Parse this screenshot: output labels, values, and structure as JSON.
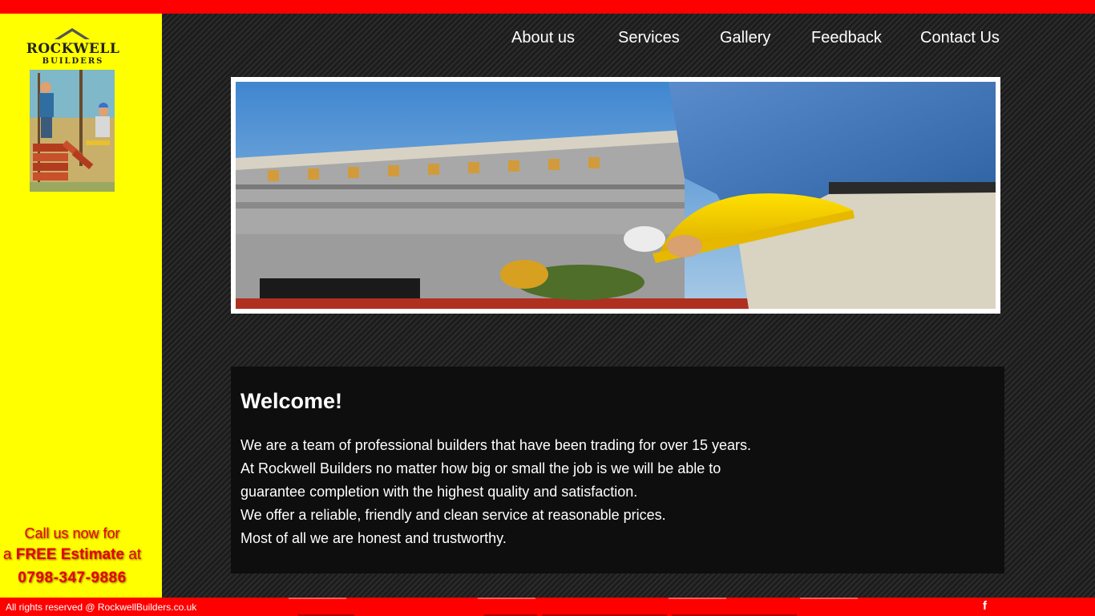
{
  "brand": {
    "logo_title": "ROCKWELL",
    "logo_sub": "BUILDERS"
  },
  "call": {
    "line1": "Call us now for",
    "line2_prefix": "a ",
    "line2_bold": "FREE Estimate",
    "line2_suffix": " at",
    "phone": "0798-347-9886"
  },
  "nav": {
    "items": [
      {
        "label": "About us"
      },
      {
        "label": "Services"
      },
      {
        "label": "Gallery"
      },
      {
        "label": "Feedback"
      },
      {
        "label": "Contact Us"
      }
    ]
  },
  "welcome": {
    "heading": "Welcome!",
    "lines": [
      "We are a team of professional builders that have been trading for over 15 years.",
      "At Rockwell Builders no matter how big or small the job is we will be able to",
      "guarantee completion with the highest quality and satisfaction.",
      "We offer a reliable, friendly and clean service at reasonable prices.",
      "Most of all we are honest and trustworthy."
    ]
  },
  "footer": {
    "copyright": "All rights reserved @ RockwellBuilders.co.uk",
    "facebook_label": "f"
  },
  "colors": {
    "top_bar": "#ff0000",
    "sidebar": "#ffff00",
    "call_text": "#e80000",
    "welcome_panel": "#0e0e0e"
  },
  "icons": {
    "facebook": "facebook-icon"
  }
}
